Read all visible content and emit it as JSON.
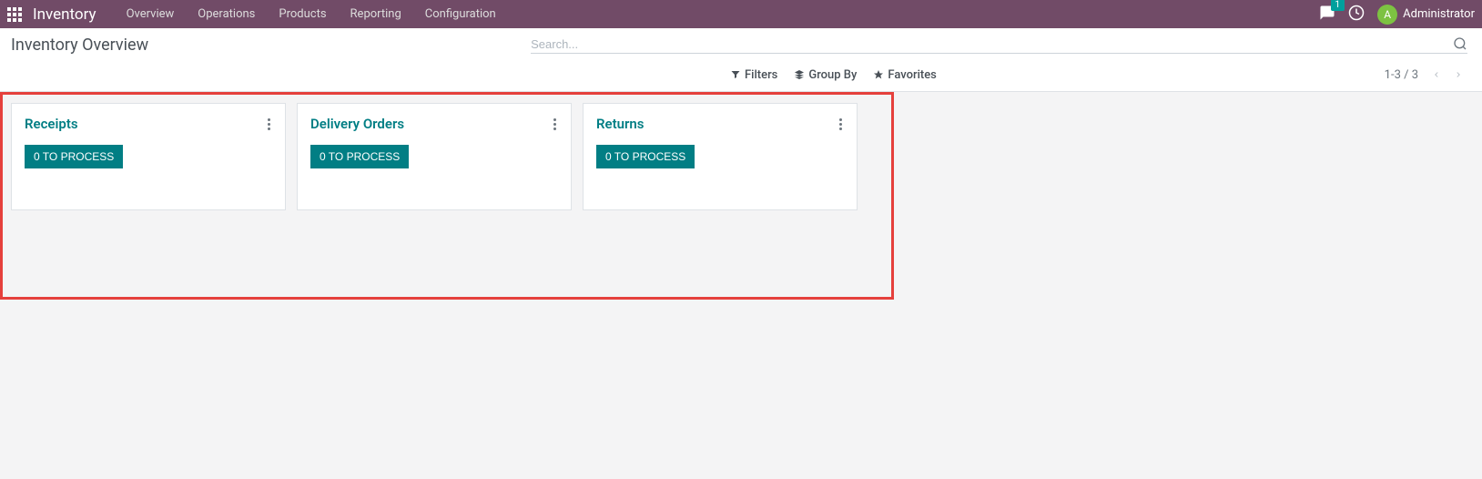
{
  "navbar": {
    "brand": "Inventory",
    "menu_items": [
      "Overview",
      "Operations",
      "Products",
      "Reporting",
      "Configuration"
    ],
    "chat_badge": "1",
    "user_initial": "A",
    "user_name": "Administrator"
  },
  "page": {
    "title": "Inventory Overview",
    "search_placeholder": "Search..."
  },
  "filters": {
    "filters_label": "Filters",
    "groupby_label": "Group By",
    "favorites_label": "Favorites"
  },
  "pager": {
    "text": "1-3 / 3"
  },
  "cards": [
    {
      "title": "Receipts",
      "button_label": "0 TO PROCESS"
    },
    {
      "title": "Delivery Orders",
      "button_label": "0 TO PROCESS"
    },
    {
      "title": "Returns",
      "button_label": "0 TO PROCESS"
    }
  ]
}
